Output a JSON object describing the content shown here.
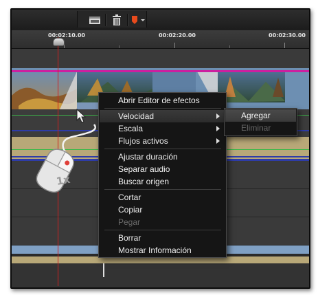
{
  "context_menu": {
    "items": [
      {
        "label": "Abrir Editor de efectos",
        "enabled": true
      },
      {
        "label": "Velocidad",
        "enabled": true,
        "highlighted": true,
        "has_submenu": true
      },
      {
        "label": "Escala",
        "enabled": true,
        "has_submenu": true
      },
      {
        "label": "Flujos activos",
        "enabled": true,
        "has_submenu": true
      },
      {
        "label": "Ajustar duración",
        "enabled": true
      },
      {
        "label": "Separar audio",
        "enabled": true
      },
      {
        "label": "Buscar origen",
        "enabled": true
      },
      {
        "label": "Cortar",
        "enabled": true
      },
      {
        "label": "Copiar",
        "enabled": true
      },
      {
        "label": "Pegar",
        "enabled": false
      },
      {
        "label": "Borrar",
        "enabled": true
      },
      {
        "label": "Mostrar Información",
        "enabled": true
      }
    ]
  },
  "submenu": {
    "items": [
      {
        "label": "Agregar",
        "enabled": true,
        "highlighted": true
      },
      {
        "label": "Eliminar",
        "enabled": false
      }
    ]
  },
  "ruler": {
    "timecodes": [
      "00:02:10.00",
      "00:02:20.00",
      "00:02:30.00"
    ]
  },
  "mouse_hint": {
    "label": "1x"
  },
  "toolbar": {
    "icons": [
      "storyboard-icon",
      "trash-icon",
      "marker-icon",
      "dropdown-arrow-icon"
    ]
  },
  "colors": {
    "playhead": "#d02020",
    "title_track_line": "#cc1fa0",
    "audio_line_blue": "#2e3ca8",
    "audio_line_green": "#3cb84a",
    "audio_band": "#b8a878",
    "video_band": "#7fa0c4"
  }
}
